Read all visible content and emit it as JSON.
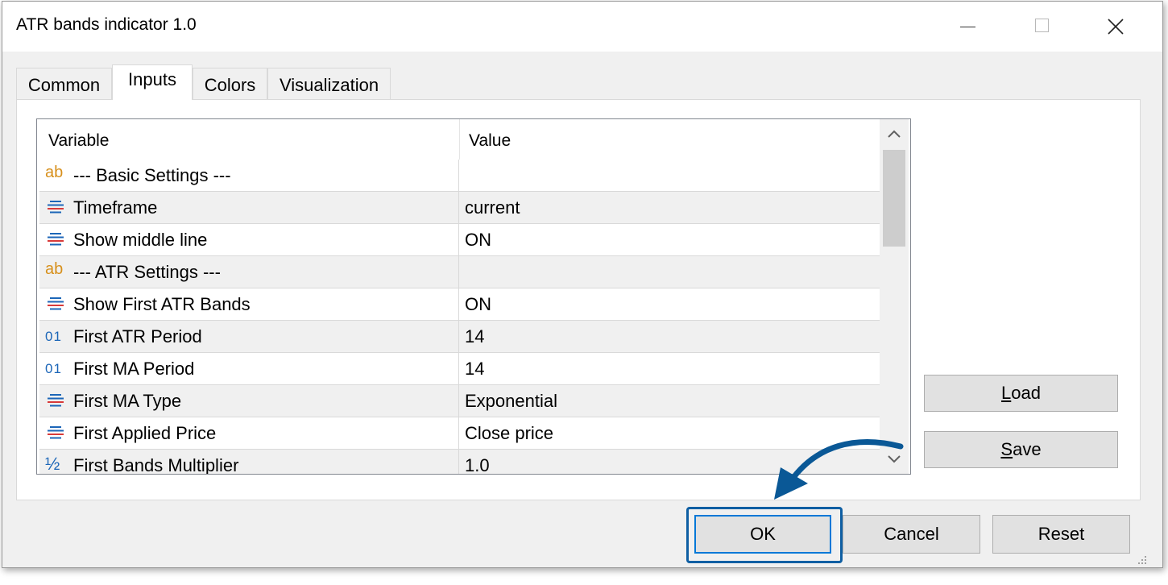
{
  "window": {
    "title": "ATR bands indicator 1.0"
  },
  "tabs": [
    {
      "label": "Common"
    },
    {
      "label": "Inputs"
    },
    {
      "label": "Colors"
    },
    {
      "label": "Visualization"
    }
  ],
  "grid": {
    "headers": {
      "variable": "Variable",
      "value": "Value"
    },
    "rows": [
      {
        "icon": "ab",
        "variable": "--- Basic Settings ---",
        "value": ""
      },
      {
        "icon": "list",
        "variable": "Timeframe",
        "value": "current"
      },
      {
        "icon": "list",
        "variable": "Show middle line",
        "value": "ON"
      },
      {
        "icon": "ab",
        "variable": "--- ATR Settings ---",
        "value": ""
      },
      {
        "icon": "list",
        "variable": "Show First ATR Bands",
        "value": "ON"
      },
      {
        "icon": "01",
        "variable": "First ATR Period",
        "value": "14"
      },
      {
        "icon": "01",
        "variable": "First MA Period",
        "value": "14"
      },
      {
        "icon": "list",
        "variable": "First MA Type",
        "value": "Exponential"
      },
      {
        "icon": "list",
        "variable": "First Applied Price",
        "value": "Close price"
      },
      {
        "icon": "½",
        "variable": "First Bands Multiplier",
        "value": "1.0"
      }
    ]
  },
  "buttons": {
    "load": {
      "prefix": "",
      "mnemonic": "L",
      "rest": "oad"
    },
    "save": {
      "prefix": "",
      "mnemonic": "S",
      "rest": "ave"
    },
    "ok": "OK",
    "cancel": "Cancel",
    "reset": "Reset"
  },
  "colors": {
    "accent": "#0078d7",
    "highlight_frame": "#0f5fa3",
    "ab_icon": "#d7901c",
    "numeric_icon": "#1c66b8"
  }
}
